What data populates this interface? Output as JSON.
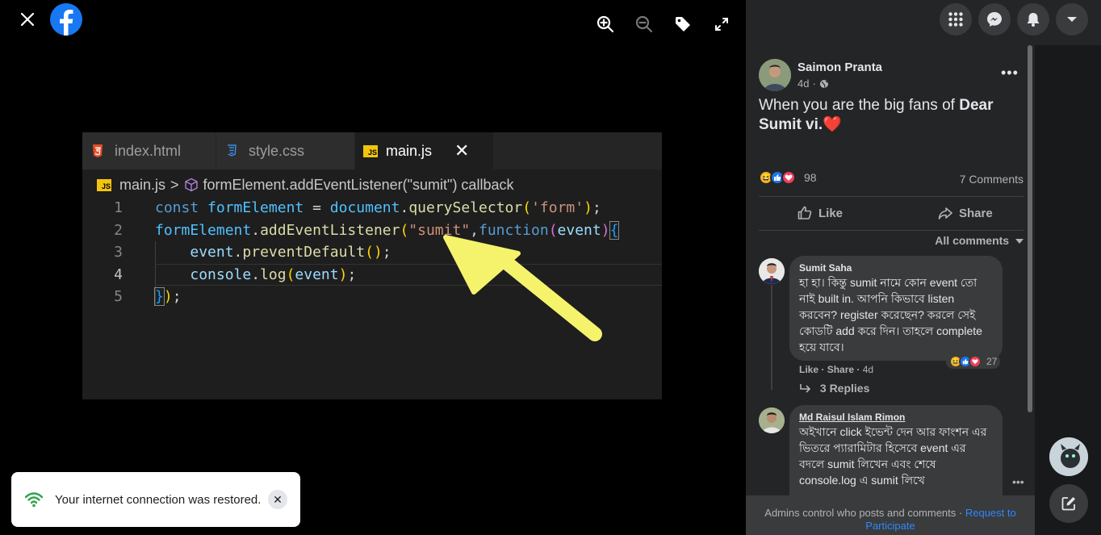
{
  "toast": {
    "message": "Your internet connection was restored."
  },
  "editor": {
    "tabs": [
      {
        "label": "index.html",
        "icon": "html5-icon"
      },
      {
        "label": "style.css",
        "icon": "css3-icon"
      },
      {
        "label": "main.js",
        "icon": "js-icon",
        "close": "✕"
      }
    ],
    "breadcrumb": {
      "file": "main.js",
      "separator": ">",
      "symbol": "formElement.addEventListener(\"sumit\") callback"
    },
    "line_numbers": [
      "1",
      "2",
      "3",
      "4",
      "5"
    ]
  },
  "post": {
    "author": "Saimon Pranta",
    "time": "4d",
    "caption_plain": "When you are the big fans of ",
    "caption_bold": "Dear Sumit vi.",
    "caption_heart": "❤️",
    "reactions_count": "98",
    "comments_count": "7 Comments",
    "like_label": "Like",
    "share_label": "Share",
    "filter_label": "All comments"
  },
  "comments": [
    {
      "author": "Sumit Saha",
      "text": "হা হা। কিন্তু sumit নামে কোন event তো নাই built in. আপনি কিভাবে listen করবেন? register করেছেন? করলে সেই কোডটি add করে দিন। তাহলে complete হয়ে যাবে।",
      "reactions": "27",
      "meta_like": "Like",
      "meta_share": "Share",
      "meta_time": "4d",
      "replies": "3 Replies"
    },
    {
      "author": "Md Raisul Islam Rimon",
      "text": "অইখানে click ইভেন্ট দেন আর ফাংশন এর ভিতরে প্যারামিটার হিসেবে event এর বদলে sumit লিখেন এবং শেষে console.log এ sumit লিখে"
    }
  ],
  "footer": {
    "text": "Admins control who posts and comments · ",
    "link": "Request to Participate"
  },
  "colors": {
    "facebook_blue": "#1877f2",
    "dark_panel": "#242526",
    "link": "#2d88ff"
  }
}
